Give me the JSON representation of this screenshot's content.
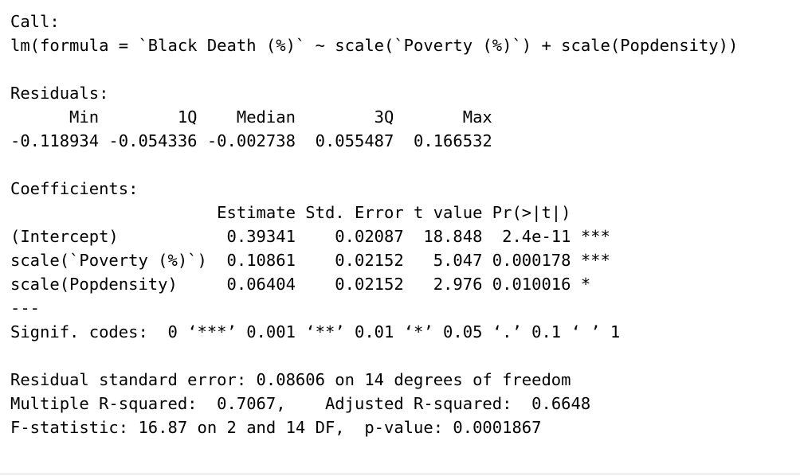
{
  "call": {
    "heading": "Call:",
    "formula": "lm(formula = `Black Death (%)` ~ scale(`Poverty (%)`) + scale(Popdensity))"
  },
  "residuals": {
    "heading": "Residuals:",
    "header": "      Min        1Q    Median        3Q       Max ",
    "values": "-0.118934 -0.054336 -0.002738  0.055487  0.166532 "
  },
  "coefficients": {
    "heading": "Coefficients:",
    "header": "                     Estimate Std. Error t value Pr(>|t|)    ",
    "rows": [
      "(Intercept)           0.39341    0.02087  18.848  2.4e-11 ***",
      "scale(`Poverty (%)`)  0.10861    0.02152   5.047 0.000178 ***",
      "scale(Popdensity)     0.06404    0.02152   2.976 0.010016 *  "
    ]
  },
  "signif": {
    "separator": "---",
    "codes": "Signif. codes:  0 ‘***’ 0.001 ‘**’ 0.01 ‘*’ 0.05 ‘.’ 0.1 ‘ ’ 1"
  },
  "summary": {
    "rse": "Residual standard error: 0.08606 on 14 degrees of freedom",
    "r_squared": "Multiple R-squared:  0.7067,\tAdjusted R-squared:  0.6648 ",
    "f_statistic": "F-statistic: 16.87 on 2 and 14 DF,  p-value: 0.0001867"
  }
}
